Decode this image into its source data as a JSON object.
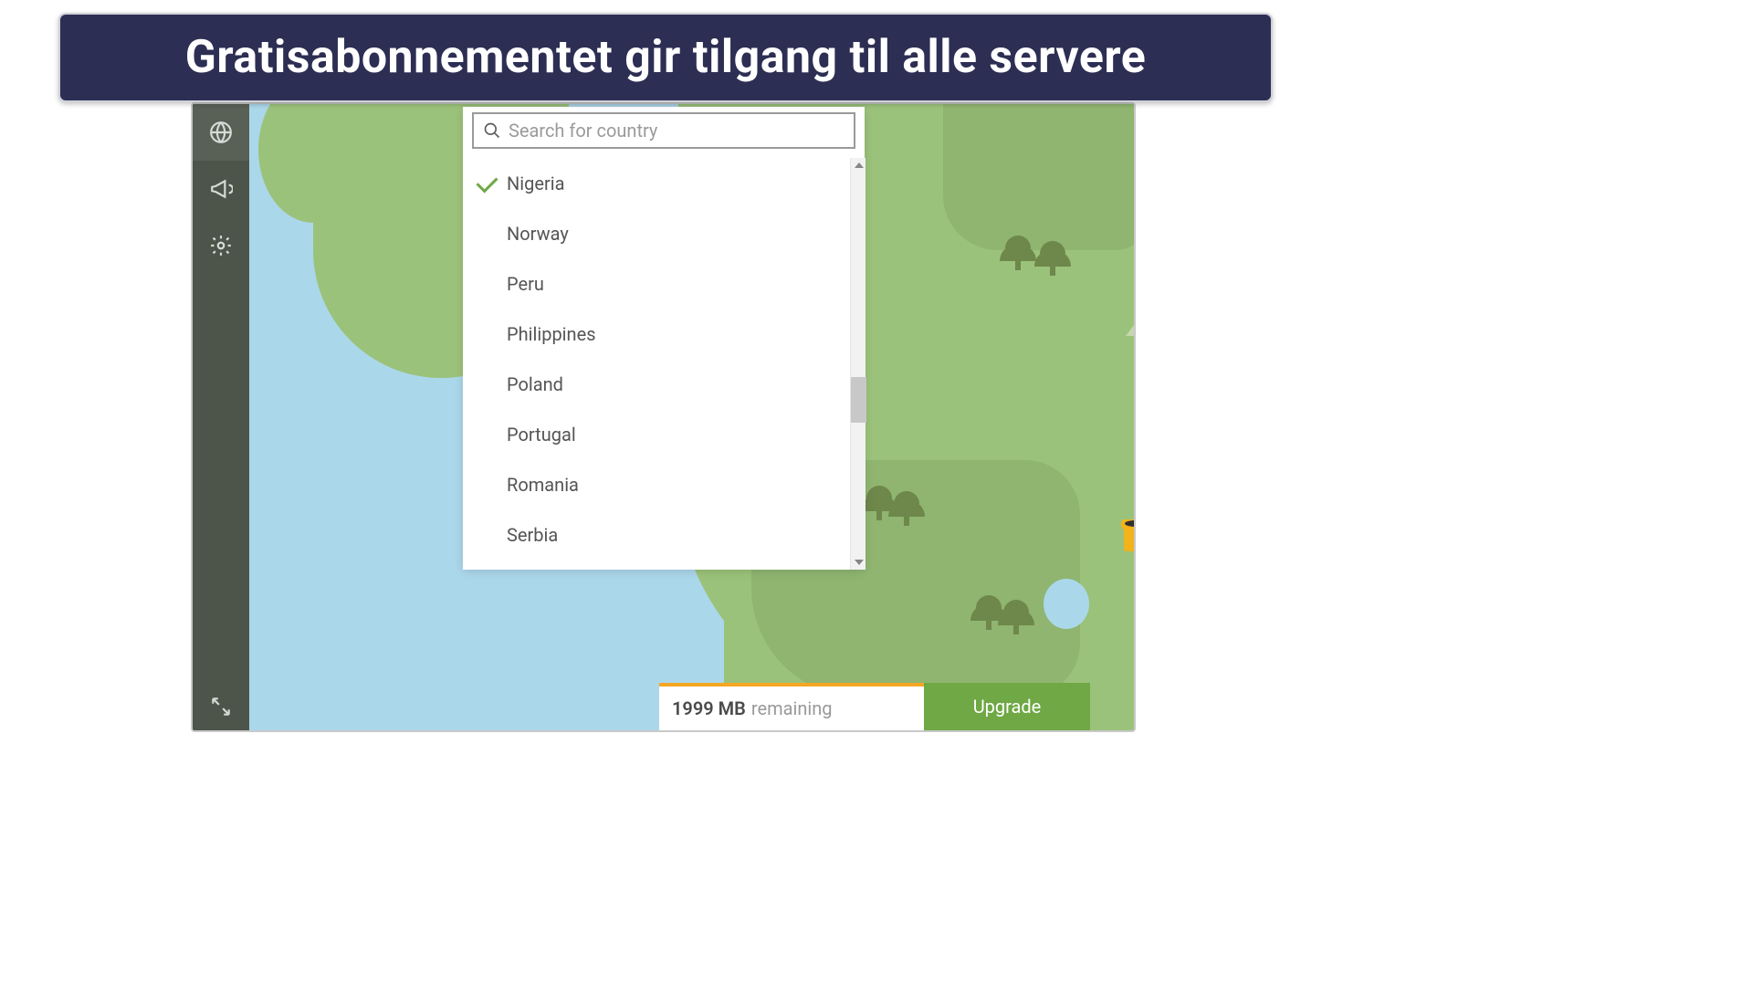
{
  "banner": {
    "title": "Gratisabonnementet gir tilgang til alle servere"
  },
  "search": {
    "placeholder": "Search for country",
    "value": ""
  },
  "countries": [
    {
      "name": "Nigeria",
      "selected": true
    },
    {
      "name": "Norway",
      "selected": false
    },
    {
      "name": "Peru",
      "selected": false
    },
    {
      "name": "Philippines",
      "selected": false
    },
    {
      "name": "Poland",
      "selected": false
    },
    {
      "name": "Portugal",
      "selected": false
    },
    {
      "name": "Romania",
      "selected": false
    },
    {
      "name": "Serbia",
      "selected": false
    }
  ],
  "usage": {
    "amount": "1999 MB",
    "label": "remaining",
    "upgrade": "Upgrade"
  },
  "sidebar": {
    "items": [
      {
        "id": "globe",
        "icon": "globe-icon",
        "active": true
      },
      {
        "id": "notify",
        "icon": "megaphone-icon",
        "active": false
      },
      {
        "id": "settings",
        "icon": "gear-icon",
        "active": false
      }
    ],
    "collapse_icon": "collapse-icon"
  }
}
